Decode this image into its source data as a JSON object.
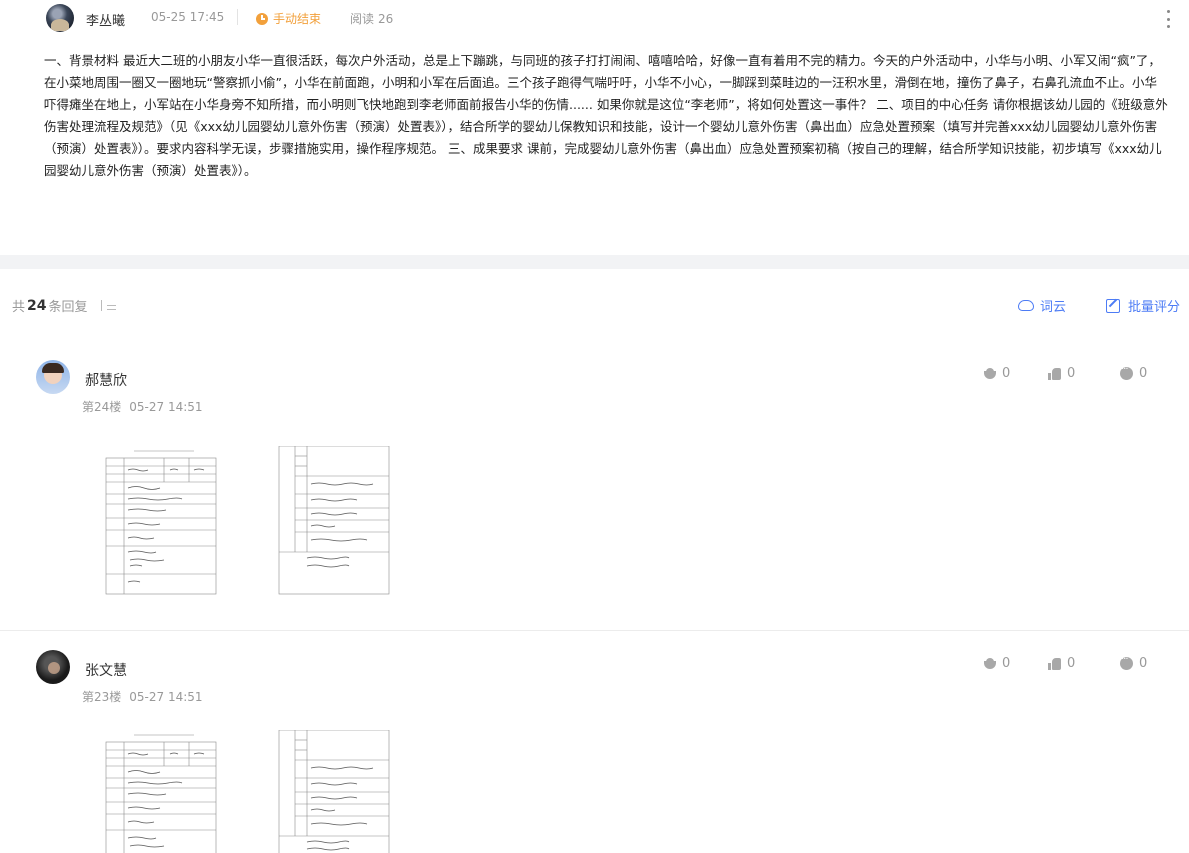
{
  "post": {
    "author": "李丛曦",
    "time": "05-25 17:45",
    "status": "手动结束",
    "read_label": "阅读",
    "read_count": "26",
    "body": "一、背景材料 最近大二班的小朋友小华一直很活跃，每次户外活动，总是上下蹦跳，与同班的孩子打打闹闹、嘻嘻哈哈，好像一直有着用不完的精力。今天的户外活动中，小华与小明、小军又闹“疯”了，在小菜地周围一圈又一圈地玩“警察抓小偷”，小华在前面跑，小明和小军在后面追。三个孩子跑得气喘吁吁，小华不小心，一脚踩到菜畦边的一汪积水里，滑倒在地，撞伤了鼻子，右鼻孔流血不止。小华吓得瘫坐在地上，小军站在小华身旁不知所措，而小明则飞快地跑到李老师面前报告小华的伤情...... 如果你就是这位“李老师”，将如何处置这一事件？ 二、项目的中心任务 请你根据该幼儿园的《班级意外伤害处理流程及规范》（见《xxx幼儿园婴幼儿意外伤害（预演）处置表》），结合所学的婴幼儿保教知识和技能，设计一个婴幼儿意外伤害（鼻出血）应急处置预案（填写并完善xxx幼儿园婴幼儿意外伤害（预演）处置表》）。要求内容科学无误，步骤措施实用，操作程序规范。 三、成果要求 课前，完成婴幼儿意外伤害（鼻出血）应急处置预案初稿（按自己的理解，结合所学知识技能，初步填写《xxx幼儿园婴幼儿意外伤害（预演）处置表》）。"
  },
  "replies_bar": {
    "prefix": "共",
    "count": "24",
    "suffix": "条回复",
    "wordcloud_label": "词云",
    "batch_label": "批量评分"
  },
  "replies": [
    {
      "name": "郝慧欣",
      "floor": "第24楼",
      "time": "05-27 14:51",
      "flowers": "0",
      "likes": "0",
      "comments": "0"
    },
    {
      "name": "张文慧",
      "floor": "第23楼",
      "time": "05-27 14:51",
      "flowers": "0",
      "likes": "0",
      "comments": "0"
    }
  ],
  "icons": {
    "post_status": "clock-icon",
    "more": "more-vertical-icon",
    "sort": "sort-icon",
    "wordcloud": "cloud-icon",
    "batch": "edit-icon",
    "flower": "flower-icon",
    "like": "thumbs-up-icon",
    "comment": "comment-icon"
  },
  "colors": {
    "accent": "#4d7cf5",
    "status": "#f2a03b",
    "muted": "#999999",
    "band": "#f2f3f5"
  }
}
